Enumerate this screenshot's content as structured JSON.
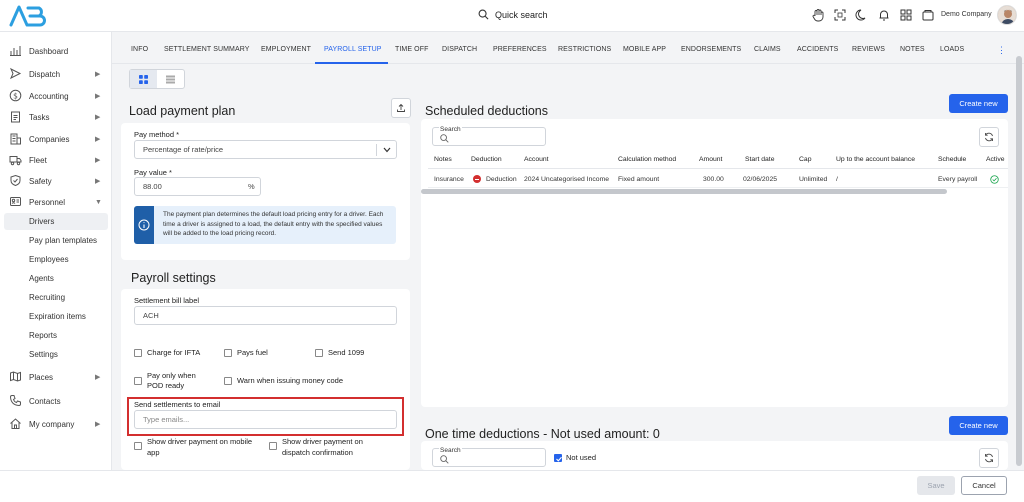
{
  "topbar": {
    "search_label": "Quick search",
    "company": "Demo Company"
  },
  "sidebar": {
    "items": [
      {
        "label": "Dashboard",
        "icon": "chart-icon",
        "chevron": false
      },
      {
        "label": "Dispatch",
        "icon": "dispatch-icon",
        "chevron": true
      },
      {
        "label": "Accounting",
        "icon": "dollar-icon",
        "chevron": true
      },
      {
        "label": "Tasks",
        "icon": "clipboard-icon",
        "chevron": true
      },
      {
        "label": "Companies",
        "icon": "building-icon",
        "chevron": true
      },
      {
        "label": "Fleet",
        "icon": "truck-icon",
        "chevron": true
      },
      {
        "label": "Safety",
        "icon": "shield-icon",
        "chevron": true
      },
      {
        "label": "Personnel",
        "icon": "id-card-icon",
        "chevron": true
      }
    ],
    "personnel_sub": [
      "Drivers",
      "Pay plan templates",
      "Employees",
      "Agents",
      "Recruiting",
      "Expiration items",
      "Reports",
      "Settings"
    ],
    "items_after": [
      {
        "label": "Places",
        "icon": "map-icon",
        "chevron": true
      },
      {
        "label": "Contacts",
        "icon": "phone-icon",
        "chevron": false
      },
      {
        "label": "My company",
        "icon": "home-icon",
        "chevron": true
      }
    ]
  },
  "tabs": [
    "INFO",
    "SETTLEMENT SUMMARY",
    "EMPLOYMENT",
    "PAYROLL SETUP",
    "TIME OFF",
    "DISPATCH",
    "PREFERENCES",
    "RESTRICTIONS",
    "MOBILE APP",
    "ENDORSEMENTS",
    "CLAIMS",
    "ACCIDENTS",
    "REVIEWS",
    "NOTES",
    "LOADS"
  ],
  "load_payment_plan": {
    "title": "Load payment plan",
    "pay_method_label": "Pay method *",
    "pay_method_value": "Percentage of rate/price",
    "pay_value_label": "Pay value *",
    "pay_value": "88.00",
    "pay_value_unit": "%",
    "info_text": "The payment plan determines the default load pricing entry for a driver. Each time a driver is assigned to a load, the default entry with the specified values will be added to the load pricing record."
  },
  "payroll_settings": {
    "title": "Payroll settings",
    "settlement_bill_label": "Settlement bill label",
    "settlement_bill_value": "ACH",
    "charge_ifta": "Charge for IFTA",
    "pays_fuel": "Pays fuel",
    "send_1099": "Send 1099",
    "pay_only_pod_1": "Pay only when",
    "pay_only_pod_2": "POD ready",
    "warn_money_code": "Warn when issuing money code",
    "send_email_label": "Send settlements to email",
    "send_email_placeholder": "Type emails...",
    "show_mobile_1": "Show driver payment on mobile",
    "show_mobile_2": "app",
    "show_dispatch_1": "Show driver payment on",
    "show_dispatch_2": "dispatch confirmation"
  },
  "scheduled": {
    "title": "Scheduled deductions",
    "create_label": "Create new",
    "search_label": "Search",
    "headers": [
      "Notes",
      "Deduction",
      "Account",
      "Calculation method",
      "Amount",
      "Start date",
      "Cap",
      "Up to the account balance",
      "Schedule",
      "Active"
    ],
    "row": {
      "notes": "Insurance",
      "deduction": "Deduction",
      "account": "2024 Uncategorised Income",
      "calc": "Fixed amount",
      "amount": "300.00",
      "start": "02/06/2025",
      "cap": "Unlimited",
      "up_to": "/",
      "schedule": "Every payroll"
    }
  },
  "one_time": {
    "title": "One time deductions - Not used amount: 0",
    "create_label": "Create new",
    "search_label": "Search",
    "not_used_label": "Not used"
  },
  "footer": {
    "save": "Save",
    "cancel": "Cancel"
  },
  "colors": {
    "accent": "#2563eb",
    "highlight": "#d32f2f",
    "deduction_dot": "#d32f2f",
    "active_check": "#16a34a"
  }
}
